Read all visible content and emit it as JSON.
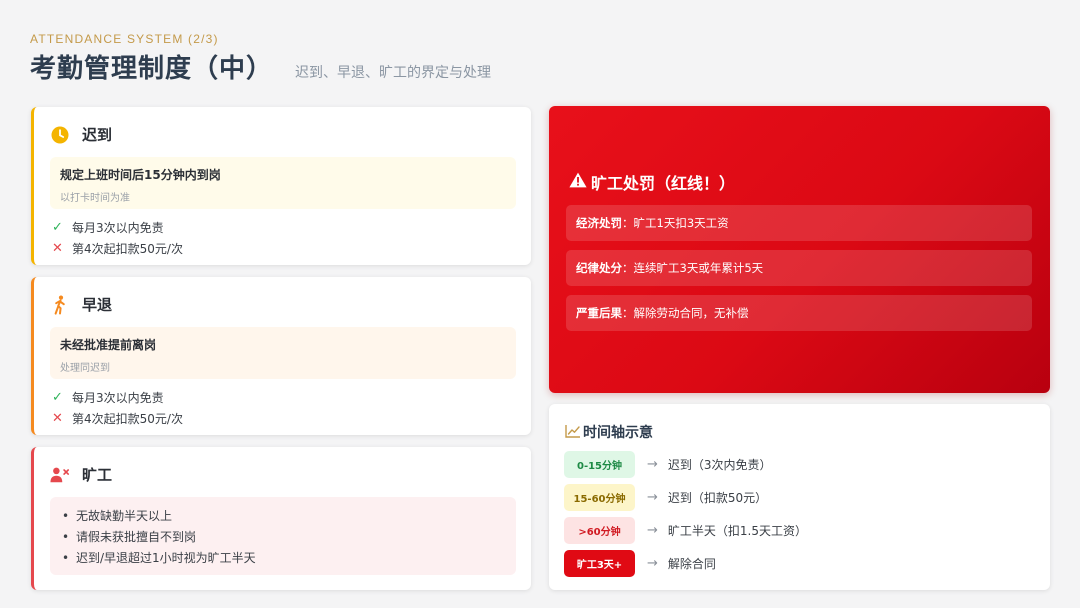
{
  "header": {
    "eyebrow": "ATTENDANCE SYSTEM (2/3)",
    "title": "考勤管理制度（中）",
    "subtitle": "迟到、早退、旷工的界定与处理"
  },
  "colors": {
    "late_accent": "#f4b400",
    "early_accent": "#f58a1f",
    "absent_accent": "#e5484d",
    "red_card": "#e00a14"
  },
  "late": {
    "icon": "clock-icon",
    "title": "迟到",
    "rule": "规定上班时间后15分钟内到岗",
    "rule_note": "以打卡时间为准",
    "items": [
      {
        "mark": "✓",
        "text": "每月3次以内免责"
      },
      {
        "mark": "✕",
        "text": "第4次起扣款50元/次"
      }
    ]
  },
  "early": {
    "icon": "walking-person-icon",
    "title": "早退",
    "rule": "未经批准提前离岗",
    "rule_note": "处理同迟到",
    "items": [
      {
        "mark": "✓",
        "text": "每月3次以内免责"
      },
      {
        "mark": "✕",
        "text": "第4次起扣款50元/次"
      }
    ]
  },
  "absent": {
    "icon": "user-x-icon",
    "title": "旷工",
    "items": [
      "无故缺勤半天以上",
      "请假未获批擅自不到岗",
      "迟到/早退超过1小时视为旷工半天"
    ]
  },
  "penalty": {
    "icon": "warning-icon",
    "title": "旷工处罚（红线！）",
    "rows": [
      {
        "key": "经济处罚",
        "value": "：旷工1天扣3天工资"
      },
      {
        "key": "纪律处分",
        "value": "：连续旷工3天或年累计5天"
      },
      {
        "key": "严重后果",
        "value": "：解除劳动合同，无补偿"
      }
    ]
  },
  "timeline": {
    "icon": "chart-line-icon",
    "title": "时间轴示意",
    "rows": [
      {
        "tag": "0-15分钟",
        "desc": "迟到（3次内免责）"
      },
      {
        "tag": "15-60分钟",
        "desc": "迟到（扣款50元）"
      },
      {
        "tag": ">60分钟",
        "desc": "旷工半天（扣1.5天工资）"
      },
      {
        "tag": "旷工3天+",
        "desc": "解除合同"
      }
    ],
    "arrow": "→"
  }
}
